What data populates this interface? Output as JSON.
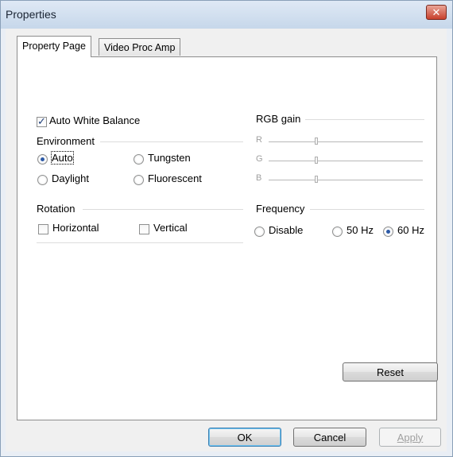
{
  "window": {
    "title": "Properties",
    "close_glyph": "✕"
  },
  "tabs": [
    {
      "label": "Property Page",
      "active": true
    },
    {
      "label": "Video Proc Amp",
      "active": false
    }
  ],
  "auto_white_balance": {
    "label": "Auto White Balance",
    "checked": true
  },
  "environment": {
    "label": "Environment",
    "options": [
      {
        "label": "Auto",
        "selected": true
      },
      {
        "label": "Tungsten",
        "selected": false
      },
      {
        "label": "Daylight",
        "selected": false
      },
      {
        "label": "Fluorescent",
        "selected": false
      }
    ]
  },
  "rotation": {
    "label": "Rotation",
    "options": [
      {
        "label": "Horizontal",
        "checked": false
      },
      {
        "label": "Vertical",
        "checked": false
      }
    ]
  },
  "rgb_gain": {
    "label": "RGB gain",
    "channels": [
      {
        "label": "R",
        "enabled": false
      },
      {
        "label": "G",
        "enabled": false
      },
      {
        "label": "B",
        "enabled": false
      }
    ]
  },
  "frequency": {
    "label": "Frequency",
    "options": [
      {
        "label": "Disable",
        "selected": false
      },
      {
        "label": "50 Hz",
        "selected": false
      },
      {
        "label": "60 Hz",
        "selected": true
      }
    ]
  },
  "buttons": {
    "reset": "Reset",
    "ok": "OK",
    "cancel": "Cancel",
    "apply": "Apply"
  }
}
